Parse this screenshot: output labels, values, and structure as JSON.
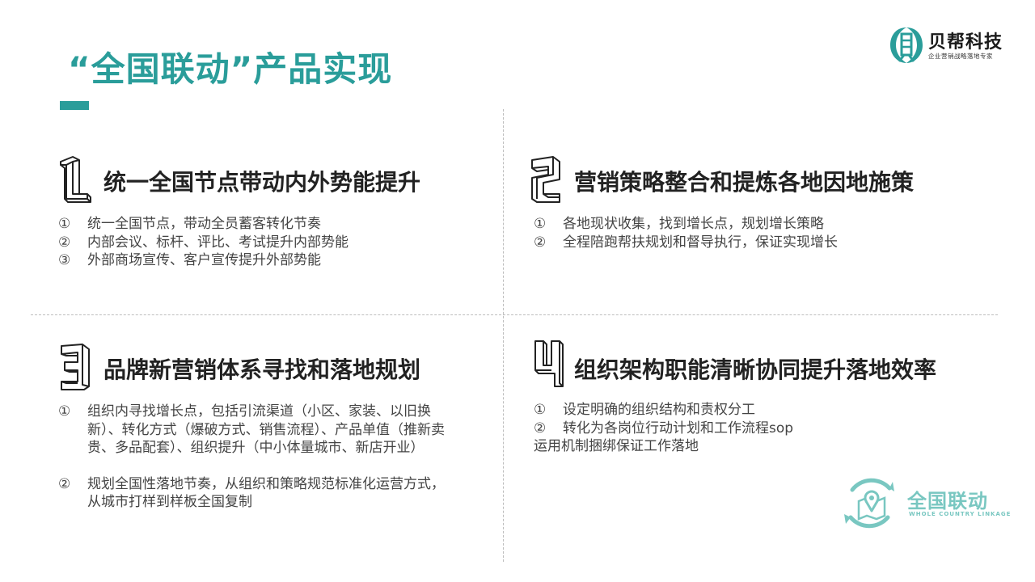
{
  "title": "“全国联动”产品实现",
  "logo": {
    "name": "贝帮科技",
    "slogan": "企业营销战略落地专家"
  },
  "sections": [
    {
      "heading": "统一全国节点带动内外势能提升",
      "items": [
        {
          "marker": "①",
          "text": "统一全国节点，带动全员蓄客转化节奏"
        },
        {
          "marker": "②",
          "text": "内部会议、标杆、评比、考试提升内部势能"
        },
        {
          "marker": "③",
          "text": "外部商场宣传、客户宣传提升外部势能"
        }
      ]
    },
    {
      "heading": "营销策略整合和提炼各地因地施策",
      "items": [
        {
          "marker": "①",
          "text": "各地现状收集，找到增长点，规划增长策略"
        },
        {
          "marker": "②",
          "text": "全程陪跑帮扶规划和督导执行，保证实现增长"
        }
      ]
    },
    {
      "heading": "品牌新营销体系寻找和落地规划",
      "items": [
        {
          "marker": "①",
          "text": "组织内寻找增长点，包括引流渠道（小区、家装、以旧换新）、转化方式（爆破方式、销售流程）、产品单值（推新卖贵、多品配套）、组织提升（中小体量城市、新店开业）"
        },
        {
          "marker": "②",
          "text": "规划全国性落地节奏，从组织和策略规范标准化运营方式，从城市打样到样板全国复制"
        }
      ]
    },
    {
      "heading": "组织架构职能清晰协同提升落地效率",
      "items": [
        {
          "marker": "①",
          "text": "设定明确的组织结构和责权分工"
        },
        {
          "marker": "②",
          "text": "转化为各岗位行动计划和工作流程sop"
        }
      ],
      "extra_line": "运用机制捆绑保证工作落地"
    }
  ],
  "badge": {
    "title": "全国联动",
    "subtitle": "WHOLE COUNTRY LINKAGE"
  },
  "colors": {
    "accent": "#2a9d9a",
    "badge": "#79c7c1"
  }
}
